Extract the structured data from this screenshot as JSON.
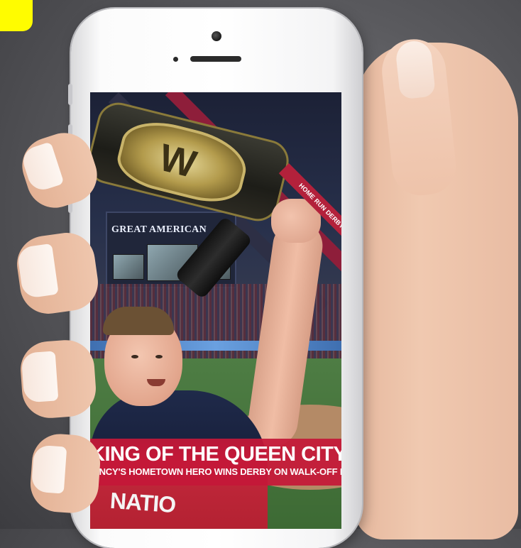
{
  "screen": {
    "stadium_sign": "GREAT AMERICAN",
    "corner_tag": "HOME RUN DERBY",
    "belt_logo": "W",
    "jersey_partial": "NATIO"
  },
  "caption": {
    "title": "KING OF THE QUEEN CITY",
    "subtitle": "CINCY'S HOMETOWN HERO WINS DERBY ON WALK-OFF HR"
  },
  "colors": {
    "corner_badge": "#fffc00",
    "caption_bg": "#c41838",
    "tag_bg": "#b3213b"
  }
}
